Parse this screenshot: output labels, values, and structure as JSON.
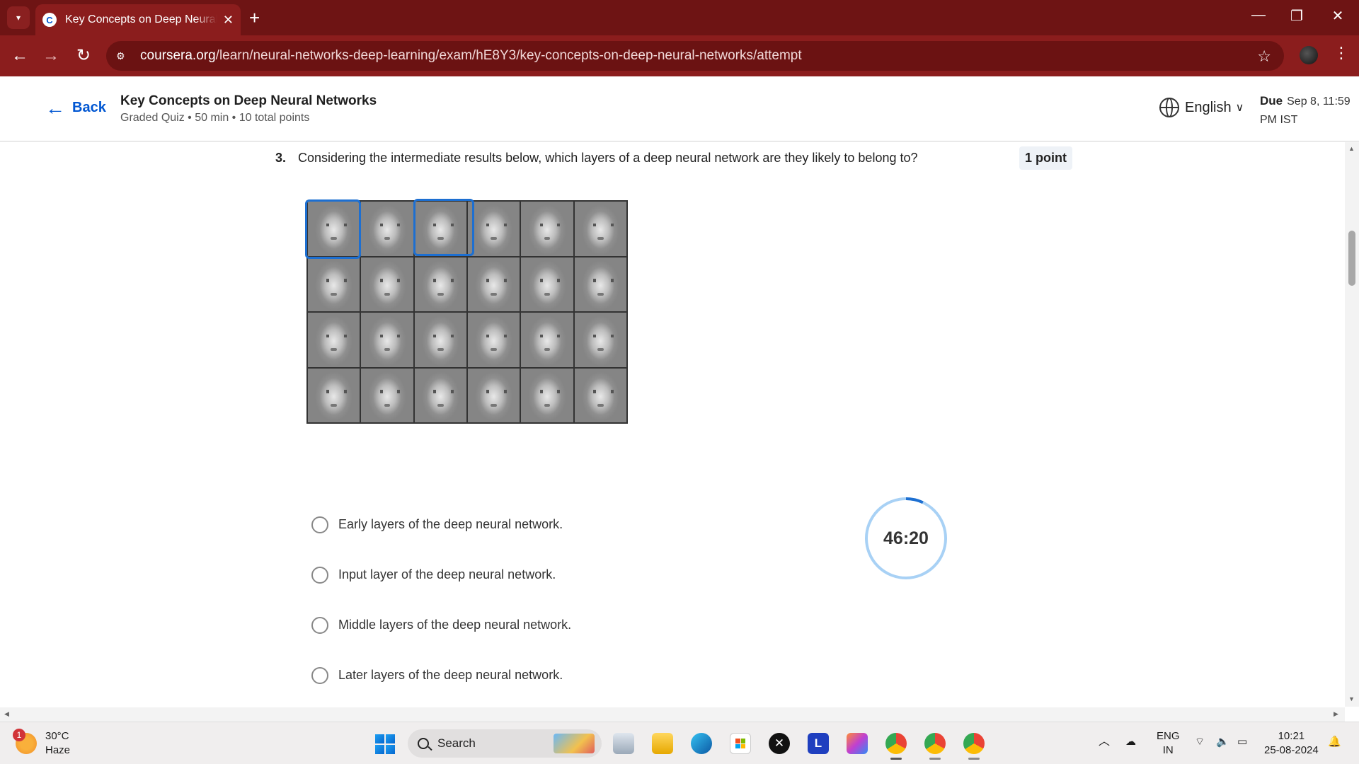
{
  "browser": {
    "tab_title": "Key Concepts on Deep Neural N",
    "favicon_letter": "C",
    "url_host": "coursera.org",
    "url_path": "/learn/neural-networks-deep-learning/exam/hE8Y3/key-concepts-on-deep-neural-networks/attempt",
    "icons": [
      "chevron-down-icon",
      "close-icon",
      "plus-icon",
      "minimize-icon",
      "restore-icon",
      "back-arrow-icon",
      "forward-arrow-icon",
      "reload-icon",
      "site-settings-icon",
      "star-icon",
      "kebab-icon"
    ]
  },
  "header": {
    "back_label": "Back",
    "quiz_title": "Key Concepts on Deep Neural Networks",
    "quiz_meta": "Graded Quiz • 50 min • 10 total points",
    "language": "English",
    "due_label": "Due",
    "due_value_line1": "Sep 8, 11:59",
    "due_value_line2": "PM IST"
  },
  "question": {
    "number": "3.",
    "text": "Considering the intermediate results below, which layers of a deep neural network are they likely to belong to?",
    "points": "1 point",
    "options": [
      "Early layers of the deep neural network.",
      "Input layer of the deep neural network.",
      "Middle layers of the deep neural network.",
      "Later layers of the deep neural network."
    ]
  },
  "timer": {
    "display": "46:20",
    "remaining_fraction": 0.93,
    "ring_color": "#a8d1f5",
    "elapsed_color": "#1d6fd1"
  },
  "taskbar": {
    "temperature": "30°C",
    "weather": "Haze",
    "weather_badge": "1",
    "search_label": "Search",
    "app_l_label": "L",
    "lang_line1": "ENG",
    "lang_line2": "IN",
    "time": "10:21",
    "date": "25-08-2024"
  },
  "colors": {
    "chrome_dark": "#6e1414",
    "chrome": "#8b1d1d",
    "accent": "#0056d2"
  }
}
